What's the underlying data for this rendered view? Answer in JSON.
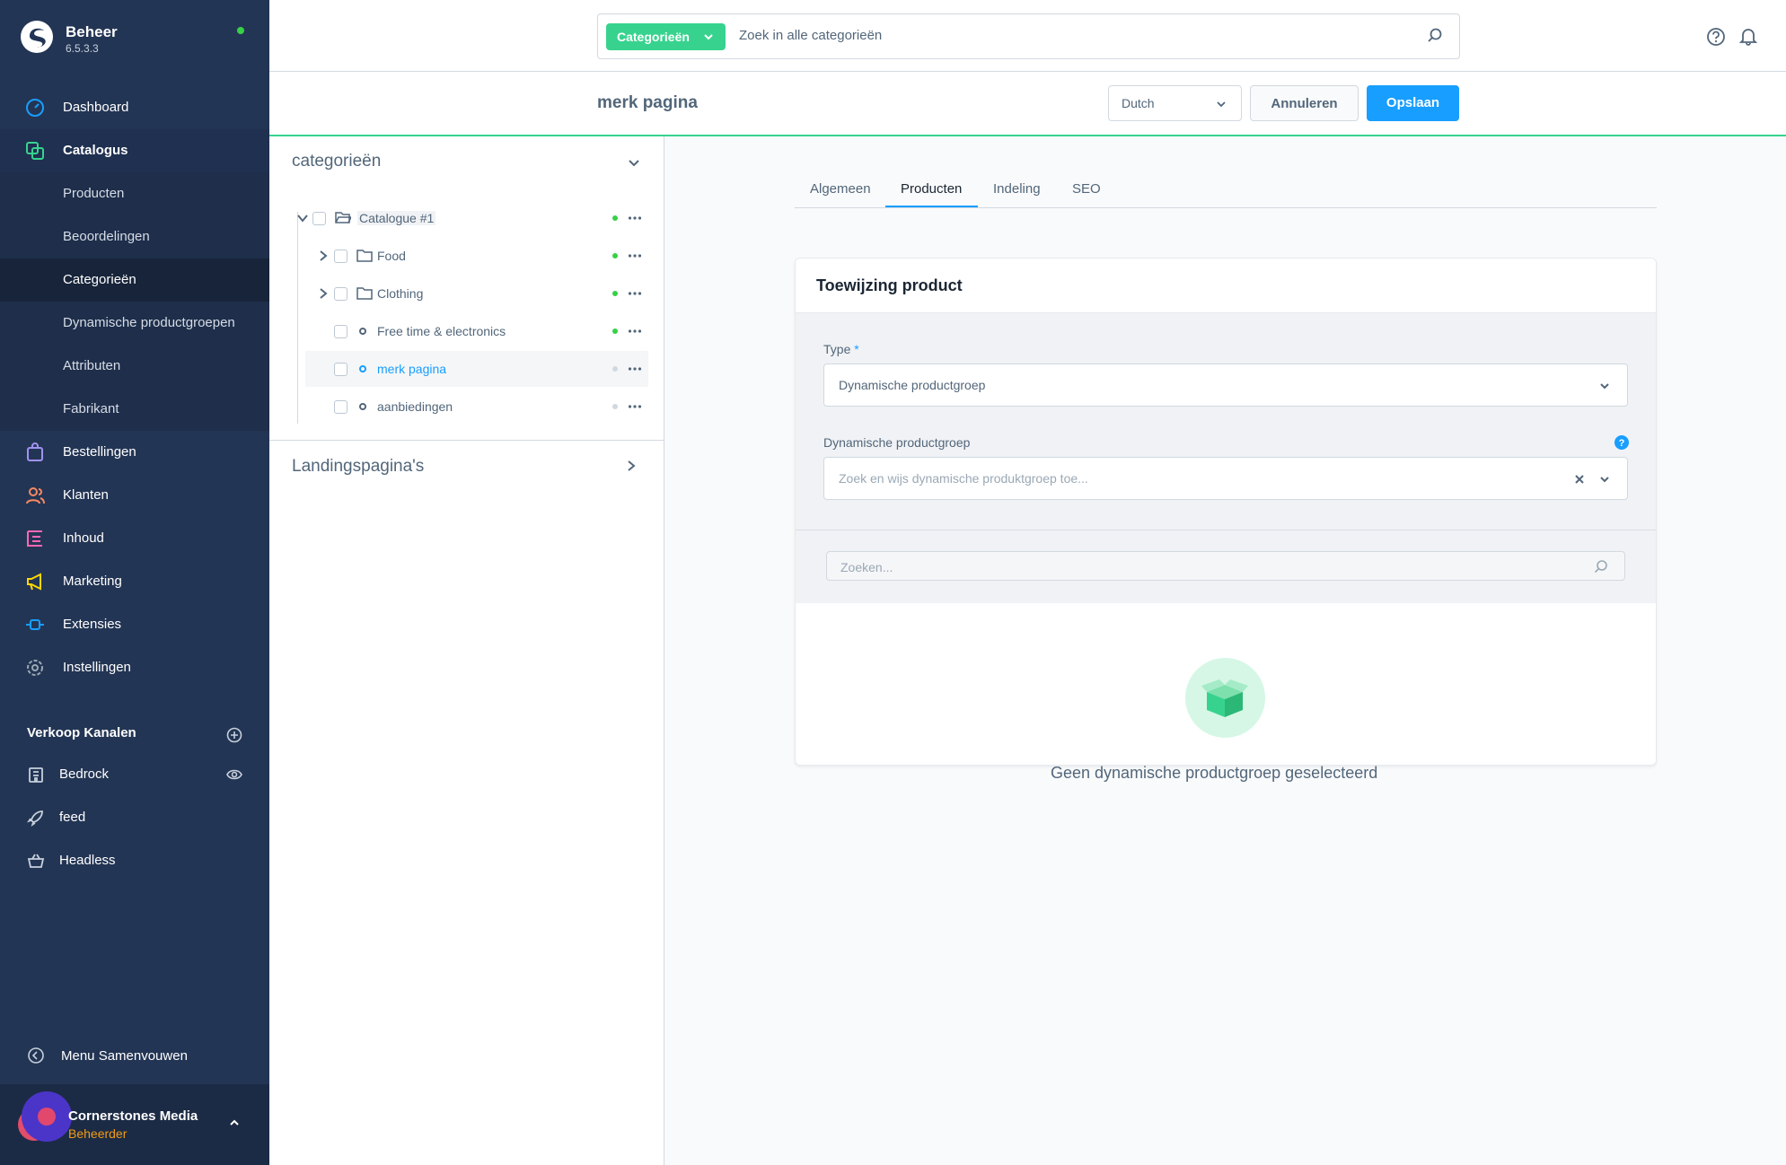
{
  "app": {
    "brand": "Beheer",
    "version": "6.5.3.3"
  },
  "nav": {
    "items": [
      {
        "label": "Dashboard"
      },
      {
        "label": "Catalogus"
      },
      {
        "label": "Bestellingen"
      },
      {
        "label": "Klanten"
      },
      {
        "label": "Inhoud"
      },
      {
        "label": "Marketing"
      },
      {
        "label": "Extensies"
      },
      {
        "label": "Instellingen"
      }
    ],
    "catalog_sub": [
      {
        "label": "Producten"
      },
      {
        "label": "Beoordelingen"
      },
      {
        "label": "Categorieën"
      },
      {
        "label": "Dynamische productgroepen"
      },
      {
        "label": "Attributen"
      },
      {
        "label": "Fabrikant"
      }
    ]
  },
  "sales_channels": {
    "title": "Verkoop Kanalen",
    "items": [
      {
        "label": "Bedrock"
      },
      {
        "label": "feed"
      },
      {
        "label": "Headless"
      }
    ]
  },
  "collapse_label": "Menu Samenvouwen",
  "user": {
    "name": "Cornerstones Media",
    "role": "Beheerder"
  },
  "search": {
    "type_label": "Categorieën",
    "placeholder": "Zoek in alle categorieën"
  },
  "smartbar": {
    "title": "merk pagina",
    "language": "Dutch",
    "cancel_label": "Annuleren",
    "save_label": "Opslaan"
  },
  "tree": {
    "title": "categorieën",
    "root": "Catalogue #1",
    "items": [
      {
        "label": "Food"
      },
      {
        "label": "Clothing"
      },
      {
        "label": "Free time & electronics"
      },
      {
        "label": "merk pagina"
      },
      {
        "label": "aanbiedingen"
      }
    ],
    "landing_title": "Landingspagina's"
  },
  "tabs": [
    {
      "label": "Algemeen"
    },
    {
      "label": "Producten"
    },
    {
      "label": "Indeling"
    },
    {
      "label": "SEO"
    }
  ],
  "card": {
    "title": "Toewijzing product",
    "type_label": "Type",
    "required_mark": "*",
    "type_value": "Dynamische productgroep",
    "group_label": "Dynamische productgroep",
    "group_placeholder": "Zoek en wijs dynamische produktgroep toe...",
    "grid_search_placeholder": "Zoeken...",
    "empty_text": "Geen dynamische productgroep geselecteerd"
  },
  "colors": {
    "sidebar": "#233554",
    "accent_green": "#37d38e",
    "primary_blue": "#189eff",
    "status_active": "#37d046",
    "role_orange": "#f39c12"
  }
}
